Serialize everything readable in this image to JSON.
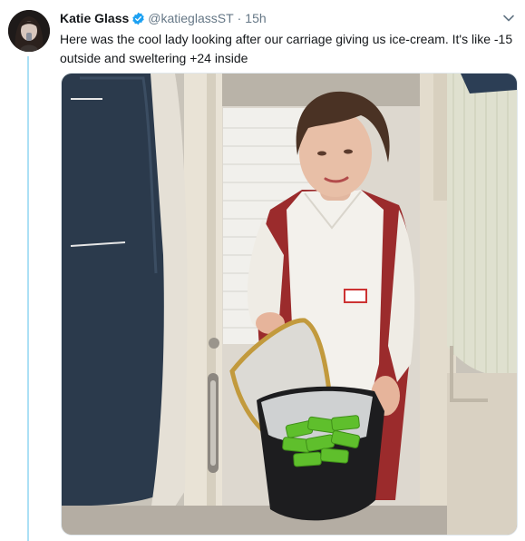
{
  "tweet": {
    "author_name": "Katie Glass",
    "author_handle": "@katieglassST",
    "separator": "·",
    "time": "15h",
    "text": "Here was the cool lady looking after our carriage giving us ice-cream. It's like -15 outside and sweltering +24 inside",
    "media": {
      "description": "photo"
    }
  },
  "icons": {
    "verified": "verified-badge-icon",
    "more": "chevron-down-icon"
  },
  "colors": {
    "verified_blue": "#1da1f2",
    "thread_line": "#ace0f5",
    "secondary_text": "#657786"
  }
}
